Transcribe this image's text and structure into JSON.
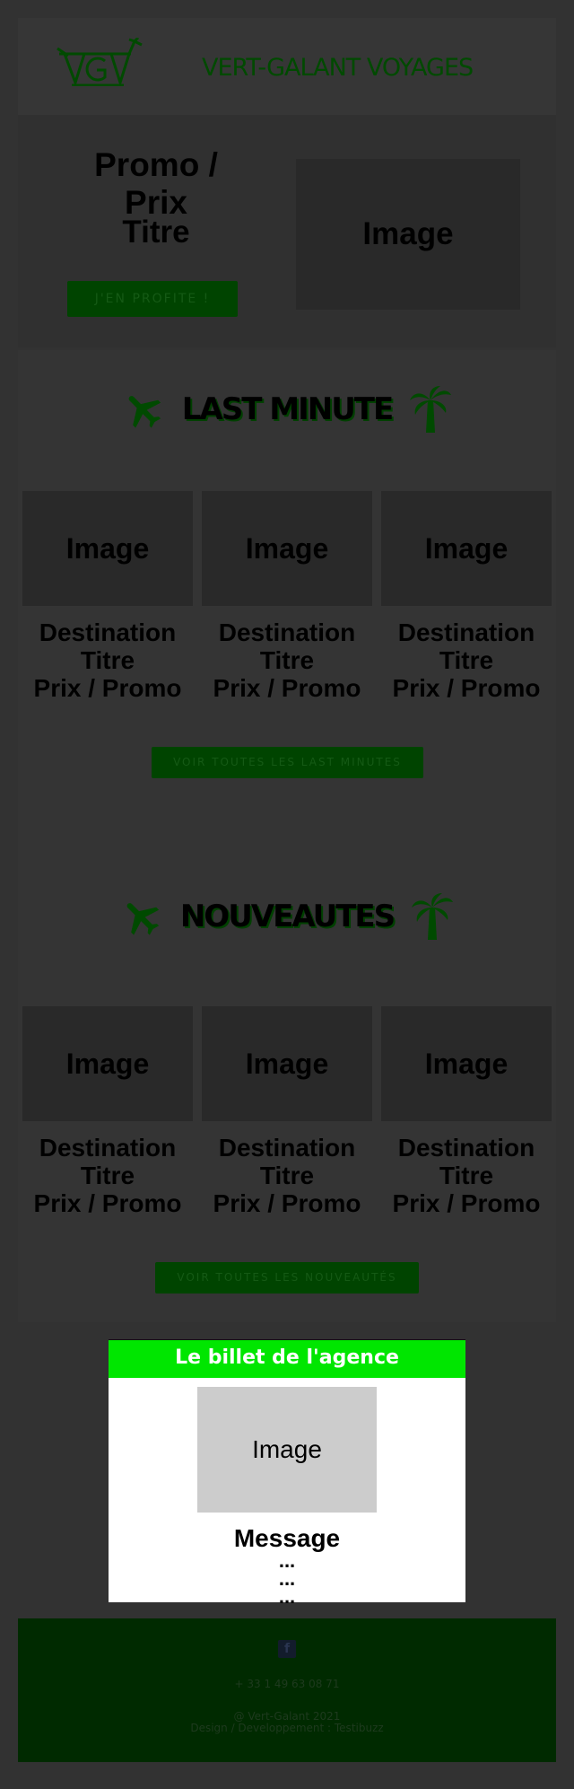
{
  "header": {
    "logo_text": "VGV",
    "title": "VERT-GALANT VOYAGES"
  },
  "hero": {
    "promo": "Promo / Prix",
    "title": "Titre",
    "button": "J'EN PROFITE !",
    "image": "Image"
  },
  "last_minute": {
    "title": "LAST MINUTE",
    "cards": [
      {
        "image": "Image",
        "destination": "Destination",
        "title": "Titre",
        "price": "Prix / Promo"
      },
      {
        "image": "Image",
        "destination": "Destination",
        "title": "Titre",
        "price": "Prix / Promo"
      },
      {
        "image": "Image",
        "destination": "Destination",
        "title": "Titre",
        "price": "Prix / Promo"
      }
    ],
    "button": "VOIR TOUTES LES LAST MINUTES"
  },
  "nouveautes": {
    "title": "NOUVEAUTES",
    "cards": [
      {
        "image": "Image",
        "destination": "Destination",
        "title": "Titre",
        "price": "Prix / Promo"
      },
      {
        "image": "Image",
        "destination": "Destination",
        "title": "Titre",
        "price": "Prix / Promo"
      },
      {
        "image": "Image",
        "destination": "Destination",
        "title": "Titre",
        "price": "Prix / Promo"
      }
    ],
    "button": "VOIR TOUTES LES NOUVEAUTÉS"
  },
  "billet": {
    "title": "Le billet de l'agence",
    "image": "Image",
    "message": "Message",
    "dots": [
      "...",
      "...",
      "..."
    ]
  },
  "footer": {
    "facebook": "f",
    "phone": "+ 33 1 49 63 08 71",
    "copyright": "@ Vert-Galant 2021",
    "credits": "Design / Developpement : Testibuzz"
  },
  "colors": {
    "accent": "#00e600",
    "dark_green": "#004400",
    "footer_bg": "#002a00"
  }
}
